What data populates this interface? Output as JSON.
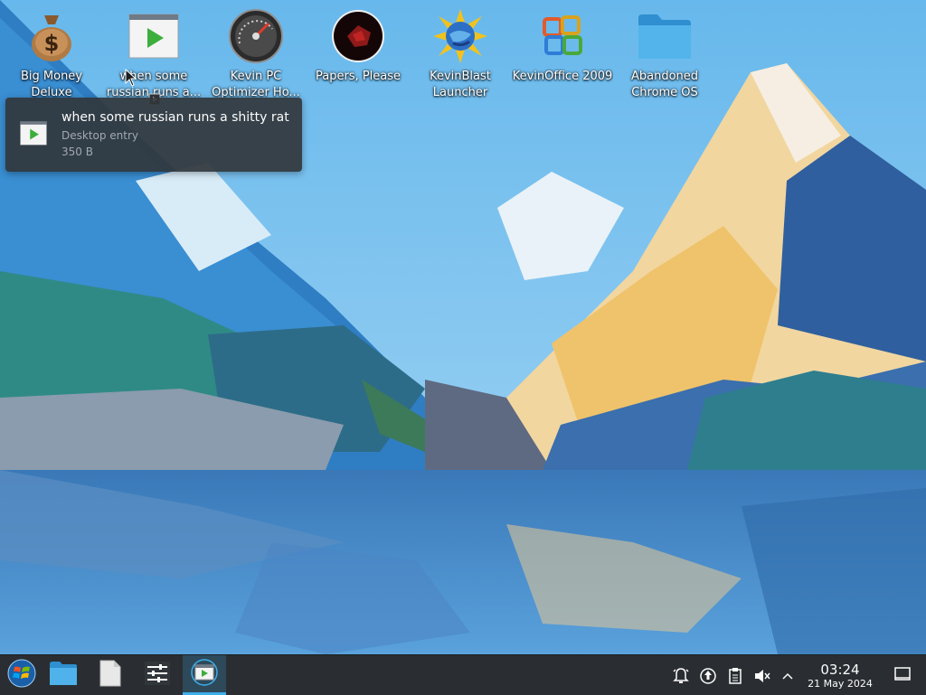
{
  "desktop": {
    "icons": [
      {
        "label": "Big Money Deluxe",
        "icon": "money-bag-icon"
      },
      {
        "label": "when some russian runs a...",
        "icon": "play-window-icon"
      },
      {
        "label": "Kevin PC Optimizer Ho...",
        "icon": "speedometer-icon"
      },
      {
        "label": "Papers, Please",
        "icon": "papers-please-icon"
      },
      {
        "label": "KevinBlast Launcher",
        "icon": "globe-burst-icon"
      },
      {
        "label": "KevinOffice 2009",
        "icon": "office-logo-icon"
      },
      {
        "label": "Abandoned Chrome OS",
        "icon": "folder-icon"
      }
    ]
  },
  "tooltip": {
    "title": "when some russian runs a shitty rat",
    "subtitle": "Desktop entry",
    "size": "350 B"
  },
  "taskbar": {
    "launcher": "start-menu-icon",
    "tasks": [
      "file-manager-icon",
      "text-document-icon",
      "settings-sliders-icon",
      "play-window-icon"
    ],
    "tray": [
      "notifications-icon",
      "updates-icon",
      "clipboard-icon",
      "volume-muted-icon",
      "expand-tray-icon"
    ],
    "clock": {
      "time": "03:24",
      "date": "21 May 2024"
    },
    "show_desktop": "show-desktop-icon"
  },
  "colors": {
    "accent": "#3daee9",
    "panel": "#2a2e32",
    "tooltip_bg": "#31363b"
  }
}
